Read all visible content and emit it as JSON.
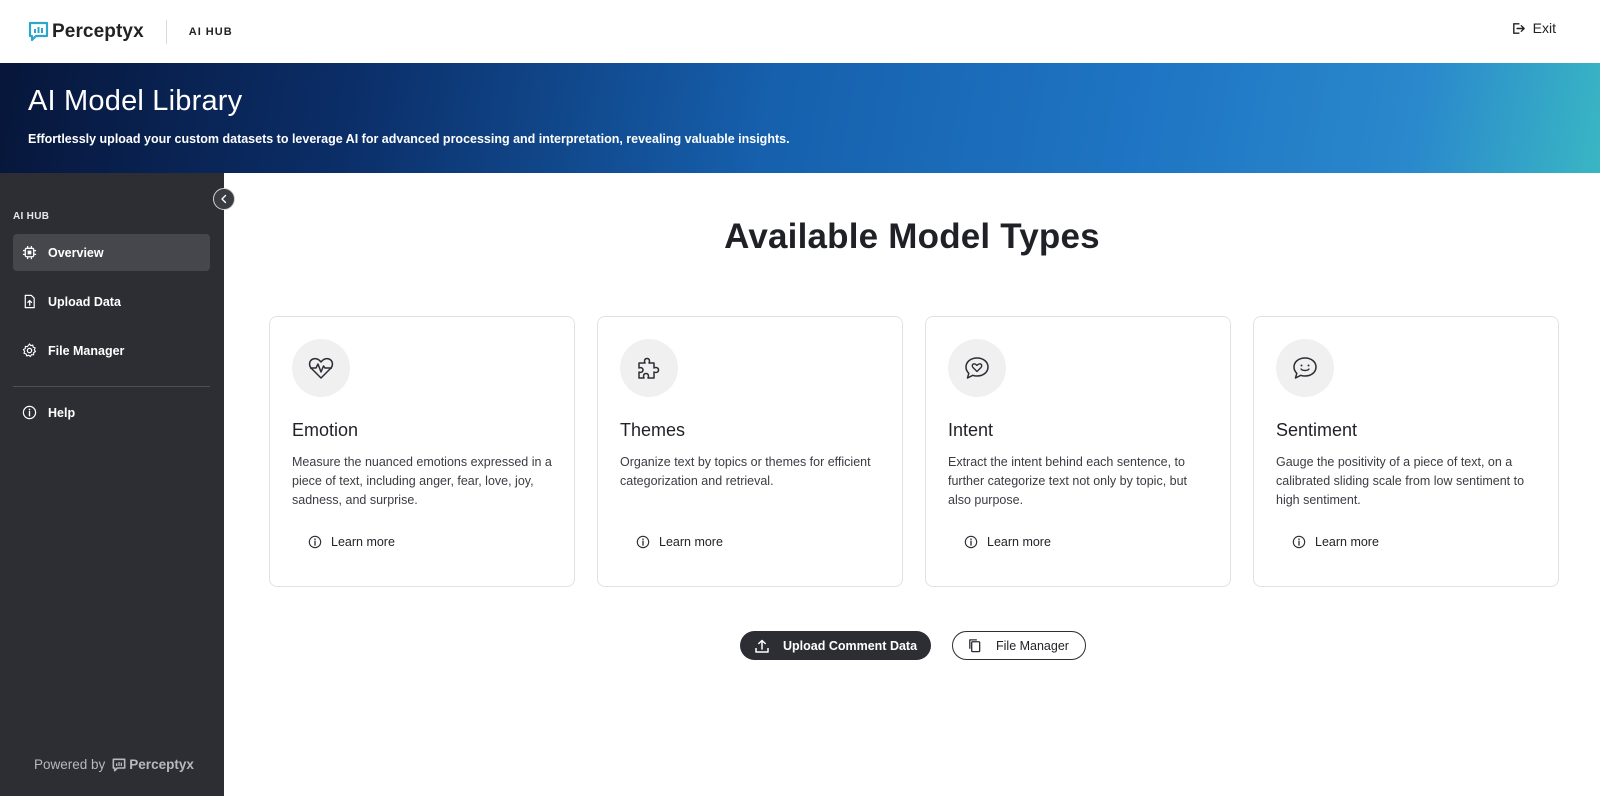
{
  "header": {
    "brand": "Perceptyx",
    "hub_label": "AI HUB",
    "exit_label": "Exit"
  },
  "banner": {
    "title": "AI Model Library",
    "subtitle": "Effortlessly upload your custom datasets to leverage AI for advanced processing and interpretation, revealing valuable insights."
  },
  "sidebar": {
    "section_label": "AI HUB",
    "items": [
      {
        "label": "Overview",
        "icon": "chip-icon",
        "active": true
      },
      {
        "label": "Upload Data",
        "icon": "file-upload-icon",
        "active": false
      },
      {
        "label": "File Manager",
        "icon": "gear-icon",
        "active": false
      },
      {
        "label": "Help",
        "icon": "info-icon",
        "active": false
      }
    ],
    "powered_by": "Powered by",
    "powered_brand": "Perceptyx"
  },
  "main": {
    "title": "Available Model Types",
    "cards": [
      {
        "title": "Emotion",
        "icon": "heart-pulse-icon",
        "description": "Measure the nuanced emotions expressed in a piece of text, including anger, fear, love, joy, sadness, and surprise.",
        "link": "Learn more"
      },
      {
        "title": "Themes",
        "icon": "puzzle-icon",
        "description": "Organize text by topics or themes for efficient categorization and retrieval.",
        "link": "Learn more"
      },
      {
        "title": "Intent",
        "icon": "heart-chat-icon",
        "description": "Extract the intent behind each sentence, to further categorize text not only by topic, but also purpose.",
        "link": "Learn more"
      },
      {
        "title": "Sentiment",
        "icon": "smile-chat-icon",
        "description": "Gauge the positivity of a piece of text, on a calibrated sliding scale from low sentiment to high sentiment.",
        "link": "Learn more"
      }
    ],
    "upload_button": "Upload Comment Data",
    "file_manager_button": "File Manager"
  },
  "colors": {
    "sidebar_bg": "#2c2e34",
    "active_item_bg": "#45474d",
    "banner_start": "#07163a",
    "banner_end": "#39b6c4",
    "brand_accent": "#2ca6c9"
  }
}
